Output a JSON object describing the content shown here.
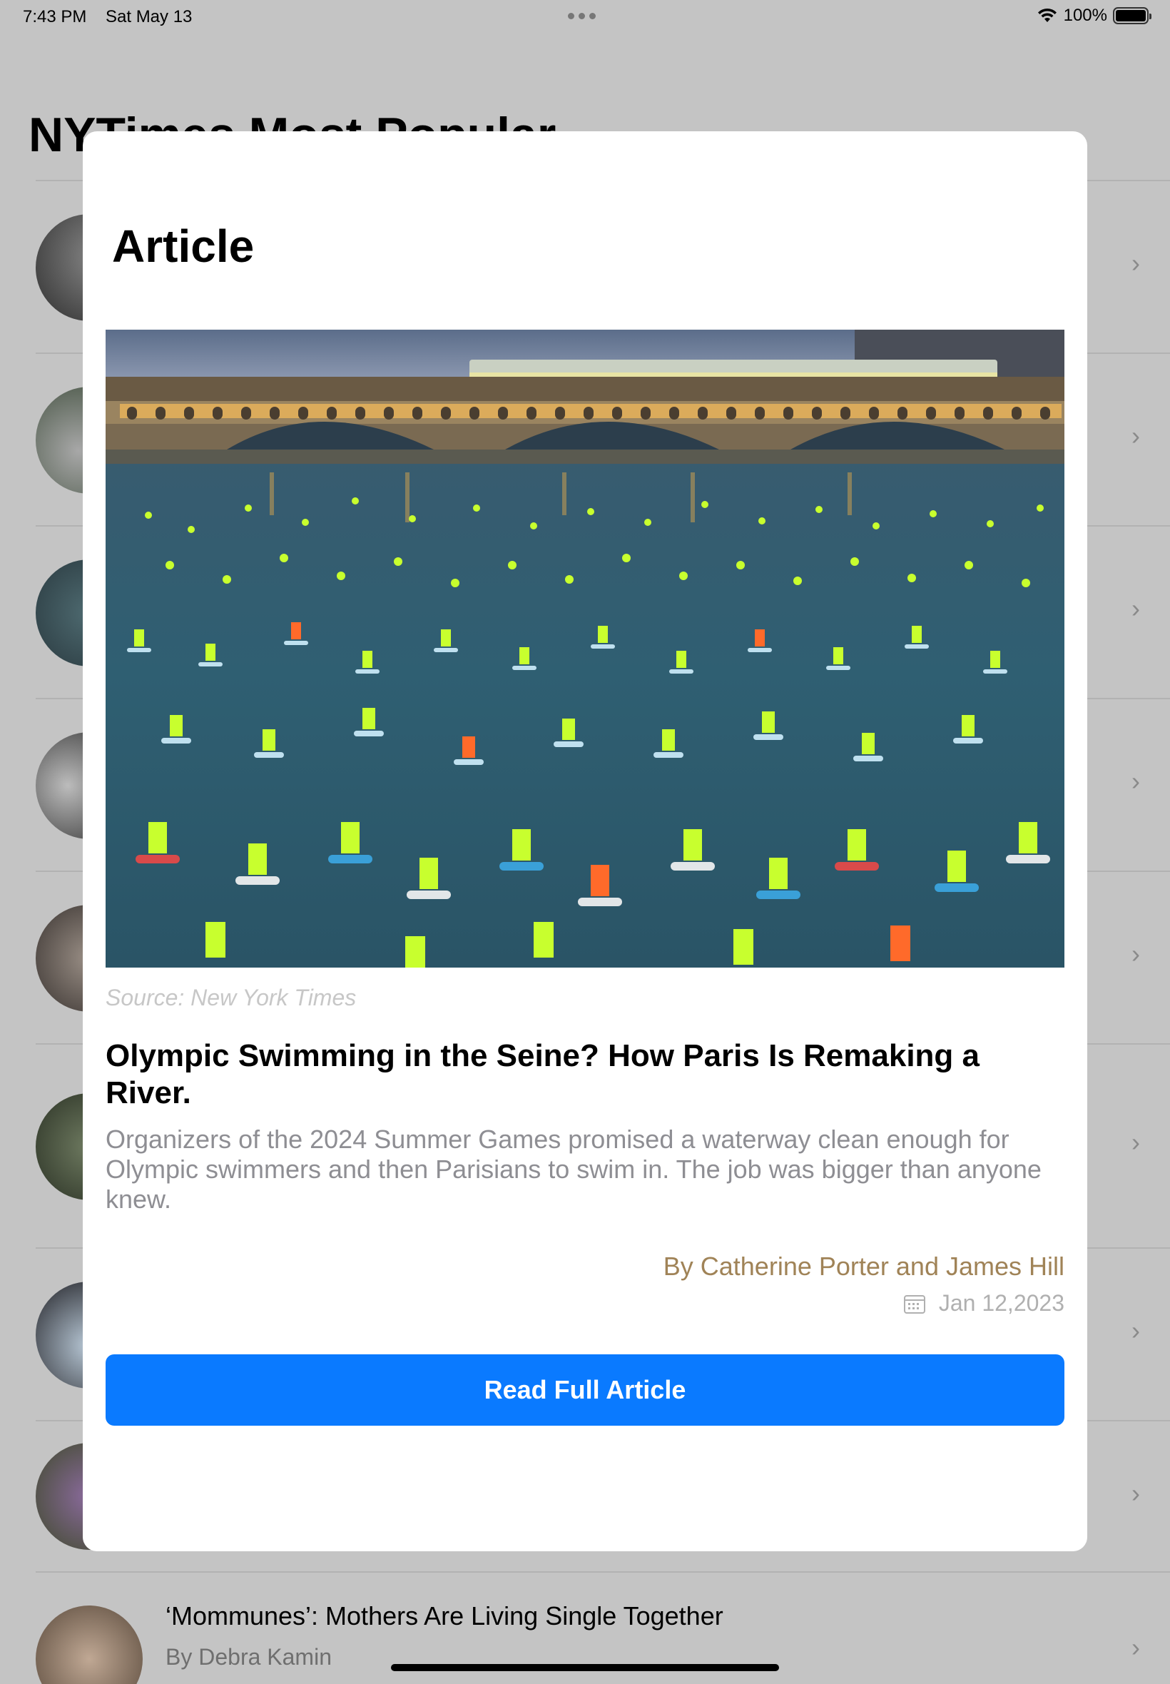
{
  "status_bar": {
    "time": "7:43 PM",
    "date": "Sat May 13",
    "battery": "100%",
    "battery_level": 1.0
  },
  "background": {
    "title": "NYTimes Most Popular",
    "last_item": {
      "title": "‘Mommunes’: Mothers Are Living Single Together",
      "byline": "By Debra Kamin"
    }
  },
  "modal": {
    "title": "Article",
    "image_source": "Source: New York Times",
    "headline": "Olympic Swimming in the Seine? How Paris Is Remaking a River.",
    "abstract": "Organizers of the 2024 Summer Games promised a waterway clean enough for Olympic swimmers and then Parisians to swim in. The job was bigger than anyone knew.",
    "byline": "By Catherine Porter and James Hill",
    "date": "Jan 12,2023",
    "button_label": "Read Full Article"
  },
  "colors": {
    "accent": "#0A7AFF",
    "byline": "#A08357",
    "dim_overlay": "#C4C4C4"
  }
}
